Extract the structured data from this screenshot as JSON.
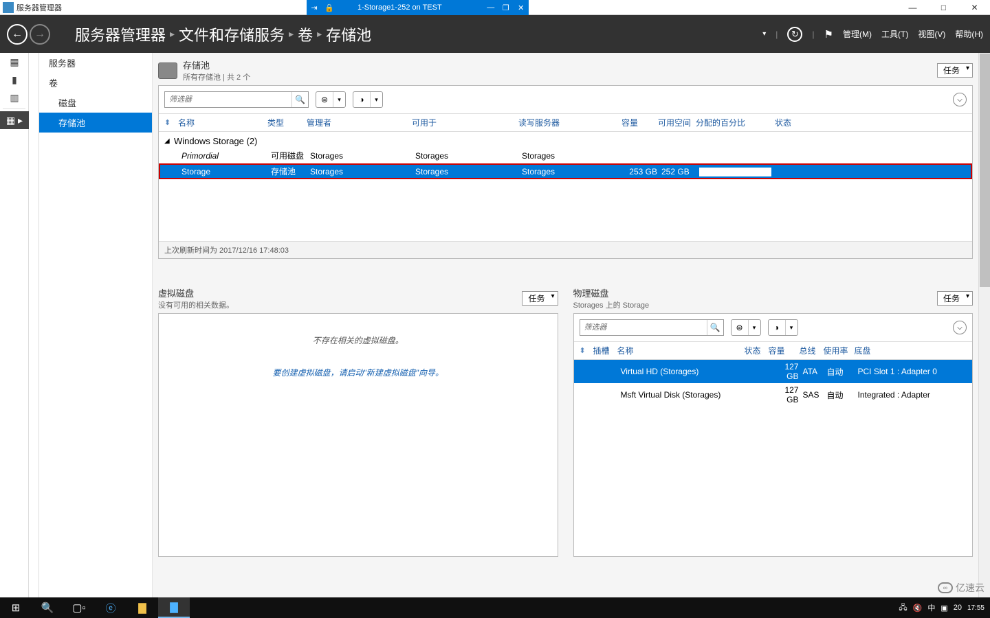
{
  "outer_window": {
    "title": "服务器管理器",
    "min": "—",
    "max": "□",
    "close": "✕"
  },
  "vm_bar": {
    "pin": "⇥",
    "lock": "🔒",
    "title": "1-Storage1-252 on TEST",
    "min": "—",
    "max": "❐",
    "close": "✕"
  },
  "header": {
    "breadcrumb": [
      "服务器管理器",
      "文件和存储服务",
      "卷",
      "存储池"
    ],
    "menus": {
      "manage": "管理(M)",
      "tools": "工具(T)",
      "view": "视图(V)",
      "help": "帮助(H)"
    }
  },
  "nav": {
    "items": [
      {
        "label": "服务器",
        "selected": false,
        "sub": false
      },
      {
        "label": "卷",
        "selected": false,
        "sub": false
      },
      {
        "label": "磁盘",
        "selected": false,
        "sub": true
      },
      {
        "label": "存储池",
        "selected": true,
        "sub": true
      }
    ]
  },
  "pools_panel": {
    "title": "存储池",
    "subtitle": "所有存储池 | 共 2 个",
    "tasks": "任务",
    "filter_placeholder": "筛选器",
    "columns": [
      "名称",
      "类型",
      "管理者",
      "可用于",
      "读写服务器",
      "容量",
      "可用空间",
      "分配的百分比",
      "状态"
    ],
    "group": "Windows Storage (2)",
    "rows": [
      {
        "name": "Primordial",
        "type": "可用磁盘",
        "mgr": "Storages",
        "avail": "Storages",
        "rw": "Storages",
        "cap": "",
        "free": "",
        "alloc": "",
        "selected": false,
        "italic": true
      },
      {
        "name": "Storage",
        "type": "存储池",
        "mgr": "Storages",
        "avail": "Storages",
        "rw": "Storages",
        "cap": "253 GB",
        "free": "252 GB",
        "alloc": "bar",
        "selected": true,
        "italic": false
      }
    ],
    "footer": "上次刷新时间为 2017/12/16 17:48:03"
  },
  "vdisk_panel": {
    "title": "虚拟磁盘",
    "subtitle": "没有可用的相关数据。",
    "tasks": "任务",
    "empty": "不存在相关的虚拟磁盘。",
    "link": "要创建虚拟磁盘，请启动\"新建虚拟磁盘\"向导。"
  },
  "pdisk_panel": {
    "title": "物理磁盘",
    "subtitle": "Storages 上的 Storage",
    "tasks": "任务",
    "filter_placeholder": "筛选器",
    "columns": [
      "插槽",
      "名称",
      "状态",
      "容量",
      "总线",
      "使用率",
      "底盘"
    ],
    "rows": [
      {
        "slot": "",
        "name": "Virtual HD (Storages)",
        "status": "",
        "cap": "127 GB",
        "bus": "ATA",
        "usage": "自动",
        "chassis": "PCI Slot 1 : Adapter 0",
        "selected": true
      },
      {
        "slot": "",
        "name": "Msft Virtual Disk (Storages)",
        "status": "",
        "cap": "127 GB",
        "bus": "SAS",
        "usage": "自动",
        "chassis": "Integrated : Adapter",
        "selected": false
      }
    ]
  },
  "taskbar": {
    "time": "17:55",
    "date": "20",
    "ime": "中",
    "tray_num": "20"
  },
  "watermark": "亿速云"
}
